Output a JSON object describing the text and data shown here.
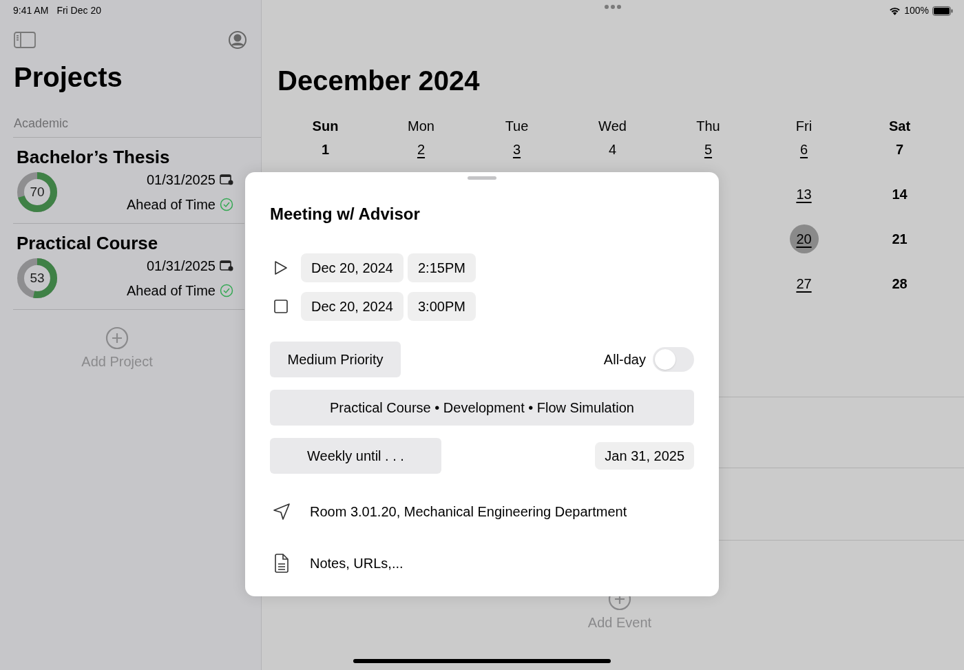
{
  "status_bar": {
    "time": "9:41 AM",
    "date": "Fri Dec 20",
    "battery": "100%"
  },
  "sidebar": {
    "title": "Projects",
    "section": "Academic",
    "projects": [
      {
        "name": "Bachelor’s Thesis",
        "progress": "70",
        "level": 0.7,
        "due": "01/31/2025",
        "status": "Ahead of Time"
      },
      {
        "name": "Practical Course",
        "progress": "53",
        "level": 0.53,
        "due": "01/31/2025",
        "status": "Ahead of Time"
      }
    ],
    "add_label": "Add Project"
  },
  "calendar": {
    "title": "December 2024",
    "weekdays": [
      {
        "label": "Sun",
        "weekend": true
      },
      {
        "label": "Mon",
        "weekend": false
      },
      {
        "label": "Tue",
        "weekend": false
      },
      {
        "label": "Wed",
        "weekend": false
      },
      {
        "label": "Thu",
        "weekend": false
      },
      {
        "label": "Fri",
        "weekend": false
      },
      {
        "label": "Sat",
        "weekend": true
      }
    ],
    "weeks": [
      {
        "days": [
          {
            "label": "1",
            "weekend": true,
            "has_events": false,
            "selected": false
          },
          {
            "label": "2",
            "weekend": false,
            "has_events": true,
            "selected": false
          },
          {
            "label": "3",
            "weekend": false,
            "has_events": true,
            "selected": false
          },
          {
            "label": "4",
            "weekend": false,
            "has_events": false,
            "selected": false
          },
          {
            "label": "5",
            "weekend": false,
            "has_events": true,
            "selected": false
          },
          {
            "label": "6",
            "weekend": false,
            "has_events": true,
            "selected": false
          },
          {
            "label": "7",
            "weekend": true,
            "has_events": false,
            "selected": false
          }
        ]
      },
      {
        "days": [
          {
            "label": "13",
            "weekend": false,
            "has_events": true,
            "selected": false
          },
          {
            "label": "14",
            "weekend": true,
            "has_events": false,
            "selected": false
          }
        ]
      },
      {
        "days": [
          {
            "label": "20",
            "weekend": false,
            "has_events": true,
            "selected": true
          },
          {
            "label": "21",
            "weekend": true,
            "has_events": false,
            "selected": false
          }
        ]
      },
      {
        "days": [
          {
            "label": "27",
            "weekend": false,
            "has_events": true,
            "selected": false
          },
          {
            "label": "28",
            "weekend": true,
            "has_events": false,
            "selected": false
          }
        ]
      }
    ],
    "add_label": "Add Event"
  },
  "event_sheet": {
    "title": "Meeting w/ Advisor",
    "start": {
      "date": "Dec 20, 2024",
      "time": "2:15PM"
    },
    "end": {
      "date": "Dec 20, 2024",
      "time": "3:00PM"
    },
    "priority": "Medium Priority",
    "all_day": {
      "label": "All-day",
      "on": false
    },
    "project_path": "Practical Course • Development • Flow Simulation",
    "repeat": "Weekly until . . .",
    "repeat_end": "Jan 31, 2025",
    "location": "Room 3.01.20, Mechanical Engineering Department",
    "notes_placeholder": "Notes, URLs,..."
  }
}
